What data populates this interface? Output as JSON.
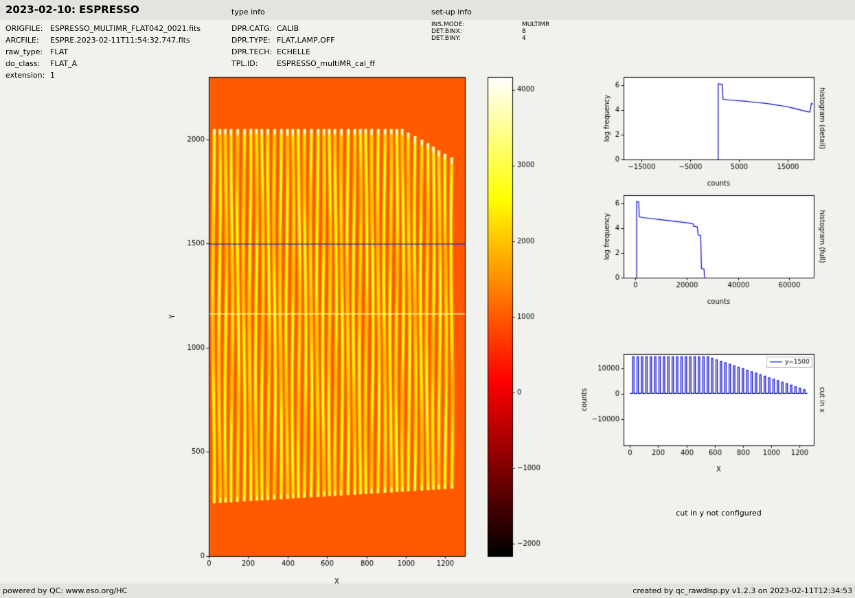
{
  "header": {
    "title": "2023-02-10: ESPRESSO",
    "type_info_label": "type info",
    "setup_info_label": "set-up info"
  },
  "file_info": {
    "rows": [
      {
        "label": "ORIGFILE:",
        "value": "ESPRESSO_MULTIMR_FLAT042_0021.fits"
      },
      {
        "label": "ARCFILE:",
        "value": "ESPRE.2023-02-11T11:54:32.747.fits"
      },
      {
        "label": "raw_type:",
        "value": "FLAT"
      },
      {
        "label": "do_class:",
        "value": "FLAT_A"
      },
      {
        "label": "extension:",
        "value": "1"
      }
    ]
  },
  "type_info": {
    "rows": [
      {
        "label": "DPR.CATG:",
        "value": "CALIB"
      },
      {
        "label": "DPR.TYPE:",
        "value": "FLAT,LAMP,OFF"
      },
      {
        "label": "DPR.TECH:",
        "value": "ECHELLE"
      },
      {
        "label": "TPL.ID:",
        "value": "ESPRESSO_multiMR_cal_ff"
      }
    ]
  },
  "setup_info": {
    "rows": [
      {
        "label": "INS.MODE:",
        "value": "MULTIMR"
      },
      {
        "label": "DET.BINX:",
        "value": "8"
      },
      {
        "label": "DET.BINY:",
        "value": "4"
      }
    ]
  },
  "notes": {
    "cut_in_y": "cut in y not configured"
  },
  "footer": {
    "left": "powered by QC: www.eso.org/HC",
    "right": "created by qc_rawdisp.py v1.2.3 on 2023-02-11T12:34:53"
  },
  "chart_data": [
    {
      "id": "raw_frame",
      "type": "heatmap",
      "title": "",
      "xlabel": "X",
      "ylabel": "Y",
      "xlim": [
        0,
        1300
      ],
      "ylim": [
        0,
        2300
      ],
      "xticks": [
        0,
        200,
        400,
        600,
        800,
        1000,
        1200
      ],
      "yticks": [
        0,
        500,
        1000,
        1500,
        2000
      ],
      "colormap": "hot",
      "vmin": -2160,
      "vmax": 4170,
      "background_value": 1000,
      "colorbar_ticks": [
        4000,
        3000,
        2000,
        1000,
        0,
        -1000,
        -2000
      ],
      "gap_line_y": 1165,
      "gap_line_value": 3600,
      "cut_line_y": 1500,
      "cut_line_color": "#2b2bc4",
      "orders": {
        "count": 40,
        "x_start": 24,
        "x_spacing": 31,
        "width": 11,
        "halo_width": 20,
        "y_bottom": 255,
        "y_bottom_slope": 1.8,
        "y_top": 2050,
        "top_droop_start": 31,
        "top_droop": 17,
        "core_value": 2380,
        "halo_value": 1680,
        "tip_value": 3920,
        "bottom_value": 3100,
        "wave_amp": 4,
        "wave_len": 260
      }
    },
    {
      "id": "histogram_detail",
      "type": "line",
      "xlabel": "counts",
      "ylabel": "log frequency",
      "side_label": "histogram (detail)",
      "line_color": "#0000cc",
      "xlim": [
        -18700,
        20300
      ],
      "ylim": [
        0,
        6.65
      ],
      "xticks": [
        -15000,
        -5000,
        5000,
        15000
      ],
      "yticks": [
        0,
        2,
        4,
        6
      ],
      "points": [
        [
          700,
          0
        ],
        [
          700,
          6.1
        ],
        [
          1500,
          6.05
        ],
        [
          1700,
          4.85
        ],
        [
          3500,
          4.78
        ],
        [
          6000,
          4.7
        ],
        [
          8500,
          4.6
        ],
        [
          10500,
          4.52
        ],
        [
          12500,
          4.4
        ],
        [
          14500,
          4.28
        ],
        [
          16000,
          4.15
        ],
        [
          17500,
          4.0
        ],
        [
          18800,
          3.87
        ],
        [
          19500,
          3.82
        ],
        [
          19800,
          4.52
        ],
        [
          20100,
          4.47
        ]
      ]
    },
    {
      "id": "histogram_full",
      "type": "line",
      "xlabel": "counts",
      "ylabel": "log frequency",
      "side_label": "histogram (full)",
      "line_color": "#0000cc",
      "xlim": [
        -4500,
        69500
      ],
      "ylim": [
        0,
        6.65
      ],
      "xticks": [
        0,
        20000,
        40000,
        60000
      ],
      "yticks": [
        0,
        2,
        4,
        6
      ],
      "points": [
        [
          600,
          0
        ],
        [
          600,
          6.15
        ],
        [
          1400,
          6.1
        ],
        [
          1600,
          4.9
        ],
        [
          3000,
          4.85
        ],
        [
          6000,
          4.78
        ],
        [
          10000,
          4.68
        ],
        [
          14000,
          4.58
        ],
        [
          18000,
          4.48
        ],
        [
          21000,
          4.4
        ],
        [
          22500,
          4.35
        ],
        [
          22800,
          4.15
        ],
        [
          24200,
          4.1
        ],
        [
          24500,
          3.45
        ],
        [
          25500,
          3.4
        ],
        [
          25800,
          0.75
        ],
        [
          26800,
          0.7
        ],
        [
          27000,
          0
        ]
      ]
    },
    {
      "id": "cut_in_x",
      "type": "line",
      "xlabel": "X",
      "ylabel": "counts",
      "side_label": "cut in x",
      "legend_label": "y=1500",
      "line_color": "#0000cc",
      "xlim": [
        -45,
        1300
      ],
      "ylim": [
        -20300,
        15800
      ],
      "xticks": [
        0,
        200,
        400,
        600,
        800,
        1000,
        1200
      ],
      "yticks": [
        -10000,
        0,
        10000
      ],
      "comb": {
        "baseline": 200,
        "x_start": 24,
        "spacing": 31,
        "half_width": 5,
        "peaks": [
          14700,
          14700,
          14700,
          14700,
          14700,
          14700,
          14700,
          14700,
          14700,
          14700,
          14700,
          14700,
          14700,
          14700,
          14700,
          14700,
          14700,
          14700,
          14110,
          13520,
          12930,
          12340,
          11750,
          11160,
          10570,
          9980,
          9390,
          8800,
          8210,
          7620,
          7030,
          6440,
          5850,
          5260,
          4670,
          4080,
          3490,
          2900,
          2310,
          1720
        ]
      }
    }
  ]
}
